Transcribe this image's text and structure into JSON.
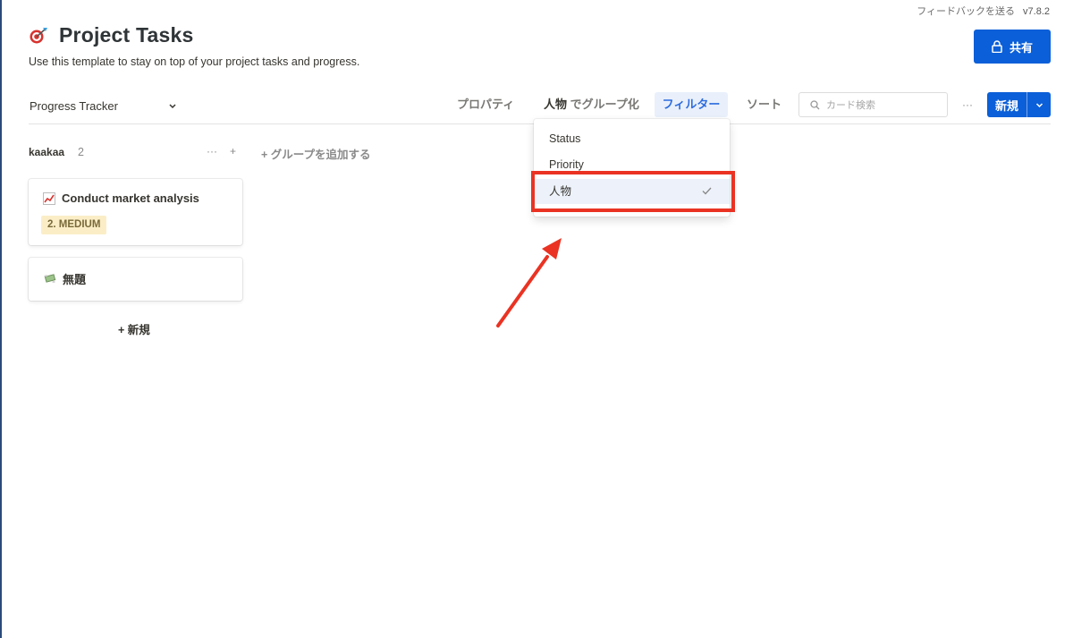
{
  "topbar": {
    "feedback": "フィードバックを送る",
    "version": "v7.8.2"
  },
  "header": {
    "icon": "target-dart-icon",
    "title": "Project Tasks",
    "description": "Use this template to stay on top of your project tasks and progress."
  },
  "share": {
    "label": "共有",
    "icon": "lock-icon"
  },
  "toolbar": {
    "view_name": "Progress Tracker",
    "properties": "プロパティ",
    "group_by_property": "人物",
    "group_by_suffix": "でグループ化",
    "filter": "フィルター",
    "sort": "ソート",
    "search_placeholder": "カード検索",
    "more": "···",
    "new_label": "新規"
  },
  "board": {
    "group": {
      "name": "kaakaa",
      "count": "2",
      "more": "···",
      "add": "+"
    },
    "add_group": "+ グループを追加する",
    "cards": [
      {
        "icon": "chart-increasing-icon",
        "title": "Conduct market analysis",
        "tag": "2. MEDIUM"
      },
      {
        "icon": "money-with-wings-icon",
        "title": "無題"
      }
    ],
    "add_card": "+ 新規"
  },
  "dropdown": {
    "items": [
      {
        "label": "Status",
        "selected": false
      },
      {
        "label": "Priority",
        "selected": false
      },
      {
        "label": "人物",
        "selected": true
      }
    ]
  },
  "annotation": {
    "highlight_color": "#ea3323",
    "arrow_color": "#ea3323"
  },
  "colors": {
    "accent": "#0b5fd8",
    "filter_active": "#2d6cdf",
    "tag_medium_bg": "#fbeec7"
  }
}
